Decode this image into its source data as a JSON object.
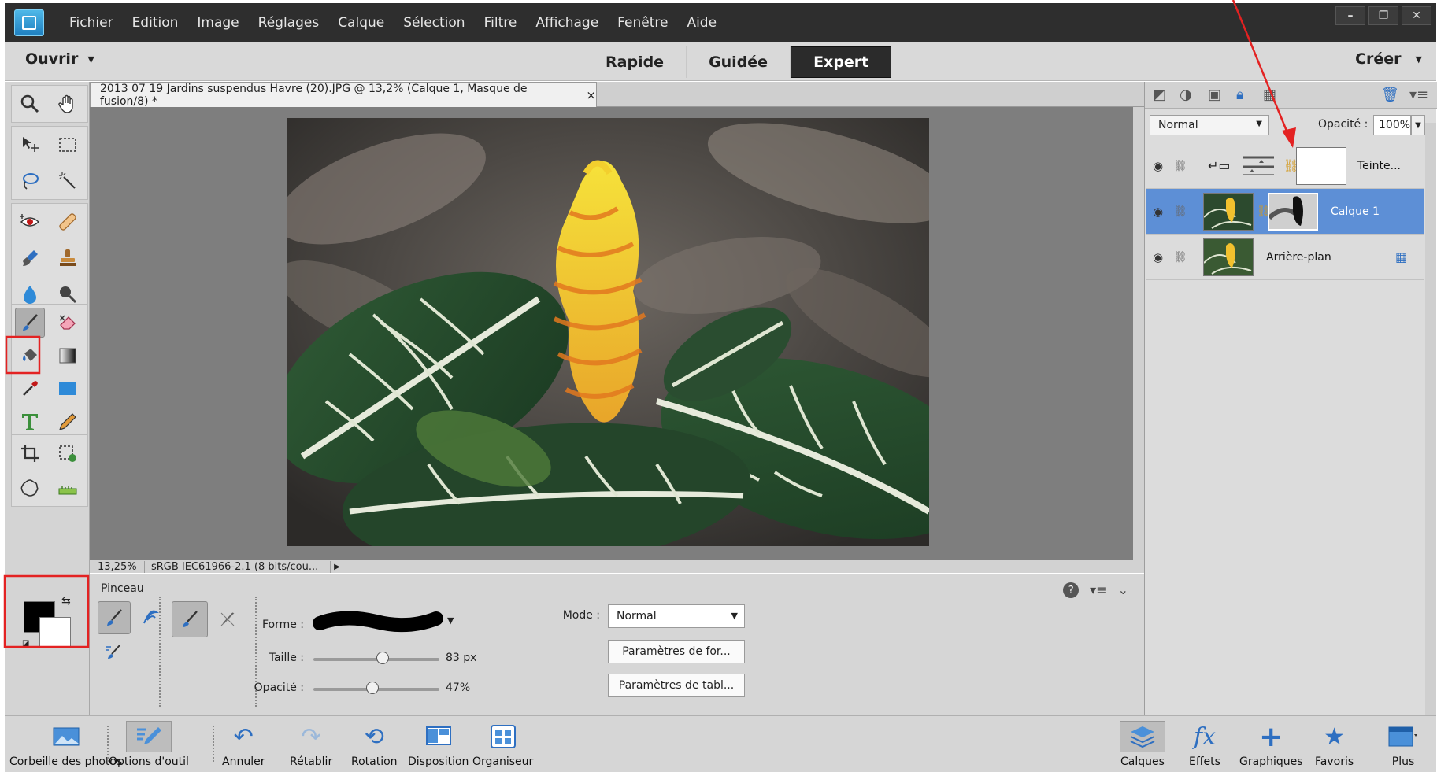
{
  "menubar": {
    "items": [
      "Fichier",
      "Edition",
      "Image",
      "Réglages",
      "Calque",
      "Sélection",
      "Filtre",
      "Affichage",
      "Fenêtre",
      "Aide"
    ]
  },
  "window_controls": {
    "minimize": "–",
    "restore": "❐",
    "close": "✕"
  },
  "modebar": {
    "open_label": "Ouvrir",
    "tabs": [
      "Rapide",
      "Guidée",
      "Expert"
    ],
    "active_tab": "Expert",
    "create_label": "Créer"
  },
  "document": {
    "tab_title": "2013 07 19 Jardins suspendus Havre (20).JPG @ 13,2% (Calque 1, Masque de fusion/8) *",
    "close_glyph": "×",
    "zoom": "13,25%",
    "profile": "sRGB IEC61966-2.1 (8 bits/cou...",
    "status_arrow": "▶"
  },
  "options": {
    "tool_name": "Pinceau",
    "shape_label": "Forme :",
    "size_label": "Taille :",
    "size_value": "83 px",
    "size_fraction": 0.55,
    "opacity_label": "Opacité :",
    "opacity_value": "47%",
    "opacity_fraction": 0.47,
    "mode_label": "Mode :",
    "mode_value": "Normal",
    "brush_settings_label": "Paramètres de for...",
    "tablet_settings_label": "Paramètres de tabl...",
    "help_glyph": "?",
    "menu_glyph": "▾≡",
    "collapse_glyph": "⌄"
  },
  "layers": {
    "blend_mode": "Normal",
    "opacity_label": "Opacité :",
    "opacity_value": "100%",
    "rows": [
      {
        "name": "Teinte...",
        "selected": false
      },
      {
        "name": "Calque 1",
        "selected": true
      },
      {
        "name": "Arrière-plan",
        "selected": false
      }
    ]
  },
  "bottombar": {
    "items": [
      {
        "label": "Corbeille des photos",
        "icon": "photo-bin-icon"
      },
      {
        "label": "Options d'outil",
        "icon": "tool-options-icon"
      },
      {
        "label": "Annuler",
        "icon": "undo-icon"
      },
      {
        "label": "Rétablir",
        "icon": "redo-icon"
      },
      {
        "label": "Rotation",
        "icon": "rotate-icon"
      },
      {
        "label": "Disposition",
        "icon": "layout-icon"
      },
      {
        "label": "Organiseur",
        "icon": "organizer-icon"
      },
      {
        "label": "Calques",
        "icon": "layers-icon"
      },
      {
        "label": "Effets",
        "icon": "effects-icon"
      },
      {
        "label": "Graphiques",
        "icon": "graphics-icon"
      },
      {
        "label": "Favoris",
        "icon": "favorites-icon"
      },
      {
        "label": "Plus",
        "icon": "more-icon"
      }
    ]
  },
  "colors": {
    "accent": "#5d8fd6",
    "annotation": "#e32222",
    "chrome_dark": "#2e2e2e"
  }
}
